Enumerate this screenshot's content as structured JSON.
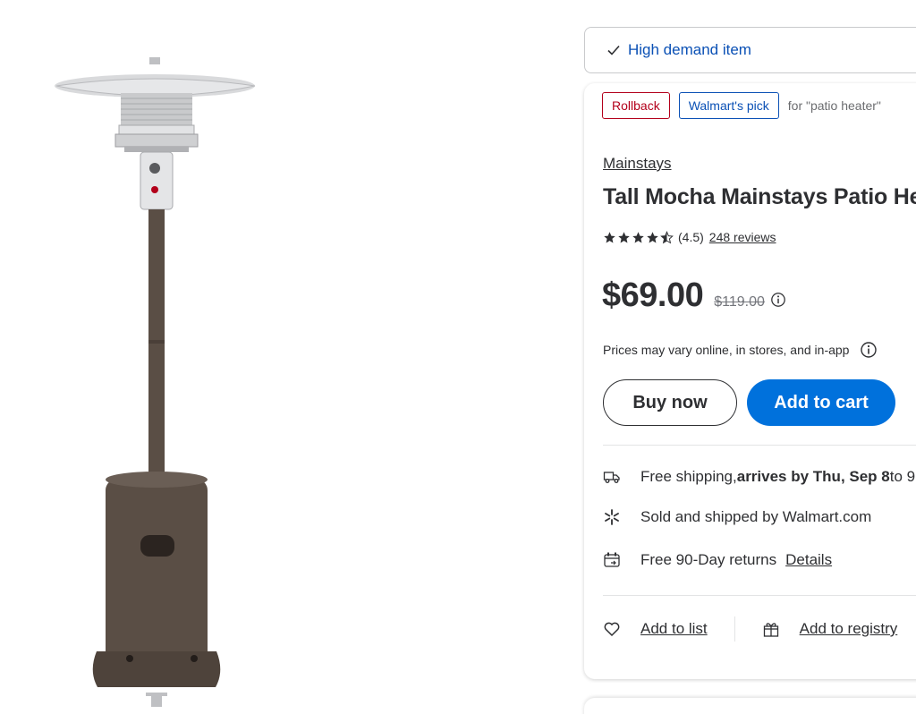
{
  "banner": {
    "text": "High demand item"
  },
  "badges": {
    "rollback": "Rollback",
    "pick": "Walmart's pick",
    "context": "for \"patio heater\""
  },
  "product": {
    "brand": "Mainstays",
    "title": "Tall Mocha Mainstays Patio Heater",
    "rating_display": "(4.5)",
    "rating": 4.5,
    "reviews_label": "248 reviews",
    "price": "$69.00",
    "was_price": "$119.00"
  },
  "price_note": "Prices may vary online, in stores, and in-app",
  "buttons": {
    "buy_now": "Buy now",
    "add_to_cart": "Add to cart"
  },
  "fulfillment": {
    "shipping_prefix": "Free shipping, ",
    "shipping_bold": "arrives by Thu, Sep 8",
    "shipping_suffix": " to 9",
    "sold_by": "Sold and shipped by Walmart.com",
    "returns": "Free 90-Day returns",
    "returns_link": "Details"
  },
  "actions": {
    "add_to_list": "Add to list",
    "add_to_registry": "Add to registry"
  },
  "colors": {
    "accent_blue": "#0071dc",
    "link_blue": "#0a50b5",
    "rollback_red": "#b3001b",
    "mocha": "#5a4e45"
  },
  "icons": [
    "checkmark-icon",
    "star-icon",
    "info-icon",
    "truck-icon",
    "spark-icon",
    "returns-icon",
    "heart-icon",
    "gift-icon"
  ]
}
